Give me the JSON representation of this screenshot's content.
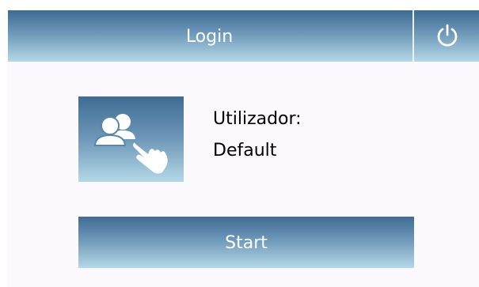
{
  "header": {
    "title": "Login",
    "power_icon": "power-icon"
  },
  "user": {
    "tile_icon": "users-select-icon",
    "label": "Utilizador:",
    "value": "Default"
  },
  "actions": {
    "start_label": "Start"
  },
  "colors": {
    "gradient_top": "#3f6b95",
    "gradient_bottom": "#b4d8e6",
    "background": "#fbf9fd",
    "text_on_accent": "#ffffff"
  }
}
